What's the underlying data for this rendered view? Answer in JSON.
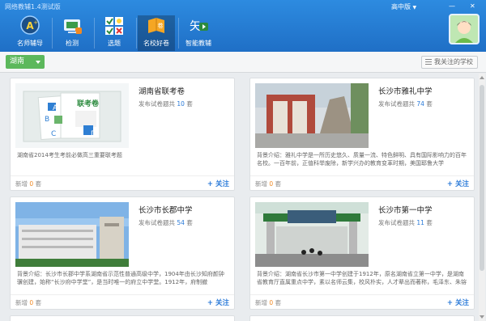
{
  "app": {
    "title": "网络教辅1.4测试版"
  },
  "window": {
    "grade_menu": "高中版",
    "grade_caret": "▼",
    "minimize": "—",
    "close": "✕"
  },
  "nav": [
    {
      "label": "名师辅导",
      "icon": "teacher-icon"
    },
    {
      "label": "检测",
      "icon": "test-icon"
    },
    {
      "label": "选题",
      "icon": "select-questions-icon"
    },
    {
      "label": "名校好卷",
      "icon": "exam-papers-icon",
      "active": true
    },
    {
      "label": "智能教辅",
      "icon": "smart-tutor-icon"
    }
  ],
  "filter": {
    "region": "湖南",
    "follow_button": "我关注的学校"
  },
  "cards": [
    {
      "title": "湖南省联考卷",
      "meta_prefix": "发布试卷题共",
      "count": "10",
      "meta_suffix": "套",
      "desc": "湖南省2014考生考前必做高三重要联考题",
      "new_prefix": "新增",
      "new_count": "0",
      "new_suffix": "套",
      "follow": "+ 关注",
      "thumb_text": "联考卷",
      "thumb_letters": [
        "A",
        "B",
        "C",
        "D"
      ]
    },
    {
      "title": "长沙市雅礼中学",
      "meta_prefix": "发布试卷题共",
      "count": "74",
      "meta_suffix": "套",
      "desc": "背景介绍：雅礼中学是一所历史悠久、质量一流、特色鲜明、具有国际影响力的百年名校。一百年前，正值科举废除，新学兴办的教育变革时期，美国耶鲁大学",
      "new_prefix": "新增",
      "new_count": "0",
      "new_suffix": "套",
      "follow": "+ 关注"
    },
    {
      "title": "长沙市长郡中学",
      "meta_prefix": "发布试卷题共",
      "count": "54",
      "meta_suffix": "套",
      "desc": "背景介绍：长沙市长郡中学系湖南省示范性普通高级中学，1904年由长沙知府颜钟骥创建，始称“长沙府中学堂”，是当时唯一的府立中学堂。1912年，府制撤",
      "new_prefix": "新增",
      "new_count": "0",
      "new_suffix": "套",
      "follow": "+ 关注"
    },
    {
      "title": "长沙市第一中学",
      "meta_prefix": "发布试卷题共",
      "count": "11",
      "meta_suffix": "套",
      "desc": "背景介绍：湖南省长沙市第一中学创建于1912年，原名湖南省立第一中学，是湖南省教育厅直属重点中学，素以名师云集，校风朴实，人才辈出而著称，毛泽东、朱镕",
      "new_prefix": "新增",
      "new_count": "0",
      "new_suffix": "套",
      "follow": "+ 关注"
    }
  ],
  "colors": {
    "topbar": "#2383d8",
    "region": "#5cb85c",
    "accent": "#2a7ad8",
    "orange": "#f08a24"
  }
}
